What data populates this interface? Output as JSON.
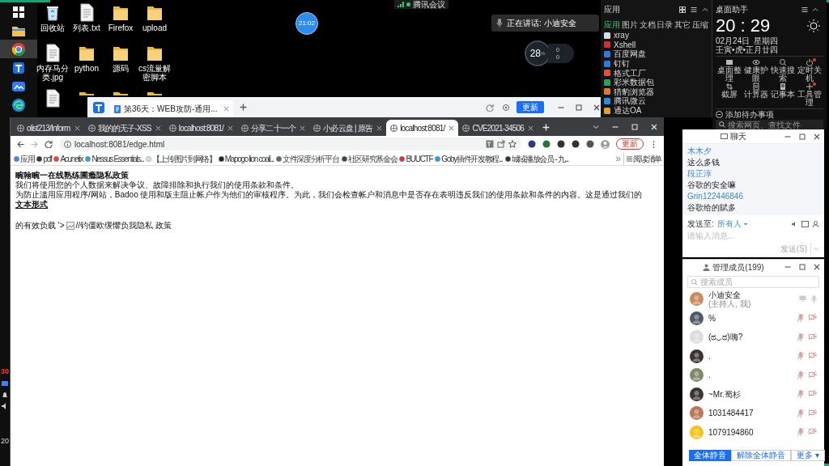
{
  "taskbar": {
    "apps": [
      {
        "kind": "windows",
        "selected": false
      },
      {
        "kind": "folder",
        "selected": false
      },
      {
        "kind": "chrome",
        "selected": true
      },
      {
        "kind": "app",
        "selected": false
      },
      {
        "kind": "meeting",
        "selected": false
      },
      {
        "kind": "edge",
        "selected": false
      }
    ],
    "badge": "30",
    "clock_fragment": "20"
  },
  "desktop_icons": [
    {
      "kind": "bin",
      "label": "回收站"
    },
    {
      "kind": "file",
      "label": "列表.txt"
    },
    {
      "kind": "folder",
      "label": "Firefox"
    },
    {
      "kind": "folder",
      "label": "upload"
    },
    {
      "kind": "file",
      "label": "内存马分类.jpg"
    },
    {
      "kind": "folder",
      "label": "python"
    },
    {
      "kind": "folder",
      "label": "源码"
    },
    {
      "kind": "folder",
      "label": "cs流量解密脚本"
    },
    {
      "kind": "file"
    },
    {
      "kind": "folder"
    },
    {
      "kind": "folder"
    },
    {
      "kind": "folder"
    }
  ],
  "meeting": {
    "title": "腾讯会议",
    "timer": "21:02",
    "speaking": "正在讲话: 小迪安全",
    "meter": {
      "value": "28",
      "unit": "%",
      "up": "0",
      "down": "0"
    }
  },
  "back_window": {
    "tab": "第36天：WEB攻防-通用...",
    "update_button": "更新"
  },
  "browser": {
    "tabs": [
      {
        "title": "olist213/Inform",
        "selected": false
      },
      {
        "title": "我的的无子-XSS",
        "selected": false
      },
      {
        "title": "localhost:8081/",
        "selected": false
      },
      {
        "title": "分享二十一个",
        "selected": false
      },
      {
        "title": "小必云盘 | 原告",
        "selected": false
      },
      {
        "title": "localhost:8081/",
        "selected": true
      },
      {
        "title": "CVE2021-34506",
        "selected": false
      }
    ],
    "address": "localhost:8081/edge.html",
    "update_button": "更新",
    "bookmarks": [
      "应用",
      "pdf",
      "Acunetix",
      "Nessus Essentials...",
      "【上传图片到网络】",
      "Mapogo lion coali...",
      "文件深度分析平台",
      "社区研究基金会",
      "BUUCTF",
      "Goby插件开发教程...",
      "城域播放会员 - 九..."
    ],
    "reading_list": "阅读清单",
    "page": {
      "heading": "畹翰畹一在线熟练圃瘾隐私政策",
      "lines": [
        "我们将使用您的个人数据来解决争议、故障排除和执行我们的使用条款和条件。",
        "为防止滥用应用程序/网站，Badoo 使用和版主阻止帐户作为他们的审核程序。为此，我们会检查帐户和消息中是否存在表明违反我们的使用条款和条件的内容。这是通过我们的"
      ],
      "link": "文本形式",
      "payload_before": "的有效负载 '>",
      "payload_after": "//钓僵欧缓懼负我隐私 政策"
    }
  },
  "apps_panel": {
    "title": "应用",
    "tabs": [
      {
        "label": "应用",
        "selected": true
      },
      {
        "label": "图片",
        "selected": false
      },
      {
        "label": "文档",
        "selected": false
      },
      {
        "label": "日录",
        "selected": false
      },
      {
        "label": "其它",
        "selected": false
      },
      {
        "label": "压缩",
        "selected": false
      }
    ],
    "items": [
      "xray",
      "Xshell",
      "百度网盘",
      "钉钉",
      "格式工厂",
      "彩米数据包",
      "猎豹浏览器",
      "腾讯微云",
      "通达OA"
    ]
  },
  "desktop_helper": {
    "title": "桌面助手",
    "time": "20 : 29",
    "date": "02月24日",
    "weekday": "星期四",
    "lunar": "壬寅•虎•正月廿四",
    "tools": [
      {
        "label": "桌面整理",
        "badge": false
      },
      {
        "label": "健康护眼",
        "badge": false
      },
      {
        "label": "快速搜索",
        "badge": false
      },
      {
        "label": "定时关机",
        "badge": true
      },
      {
        "label": "截屏",
        "badge": false
      },
      {
        "label": "计算器",
        "badge": false
      },
      {
        "label": "记事本",
        "badge": false
      },
      {
        "label": "工具管理",
        "badge": true
      }
    ],
    "todo": "添加待办事项",
    "search_placeholder": "搜索网页、查找文件"
  },
  "chat": {
    "title": "聊天",
    "messages": [
      {
        "kind": "sender",
        "text": "木木夕"
      },
      {
        "kind": "message",
        "text": "这么多钱"
      },
      {
        "kind": "sender",
        "text": "段正淳"
      },
      {
        "kind": "message",
        "text": "谷歌的安全嘛"
      },
      {
        "kind": "sender",
        "text": "Grin122446846"
      },
      {
        "kind": "message",
        "text": "谷歌给的賦多"
      }
    ],
    "send_to": "发送至:",
    "recipient": "所有人",
    "placeholder": "请输入消息...",
    "send_button": "发送(S)"
  },
  "members": {
    "title": "管理成员(199)",
    "search_placeholder": "搜索成员",
    "list": [
      {
        "name": "小迪安全",
        "role": "(主持人, 我)",
        "muted": false
      },
      {
        "name": "%",
        "muted": true
      },
      {
        "name": "(ಥ◡ಥ)嗨?",
        "muted": true
      },
      {
        "name": ".",
        "muted": true
      },
      {
        "name": ".",
        "muted": true
      },
      {
        "name": "~Mr.蜀杉",
        "muted": true
      },
      {
        "name": "1031484417",
        "muted": true
      },
      {
        "name": "1079194860",
        "muted": true
      }
    ],
    "buttons": [
      {
        "label": "全体静音",
        "kind": "primary"
      },
      {
        "label": "解除全体静音",
        "kind": "normal"
      },
      {
        "label": "更多 ▾",
        "kind": "normal"
      }
    ]
  }
}
